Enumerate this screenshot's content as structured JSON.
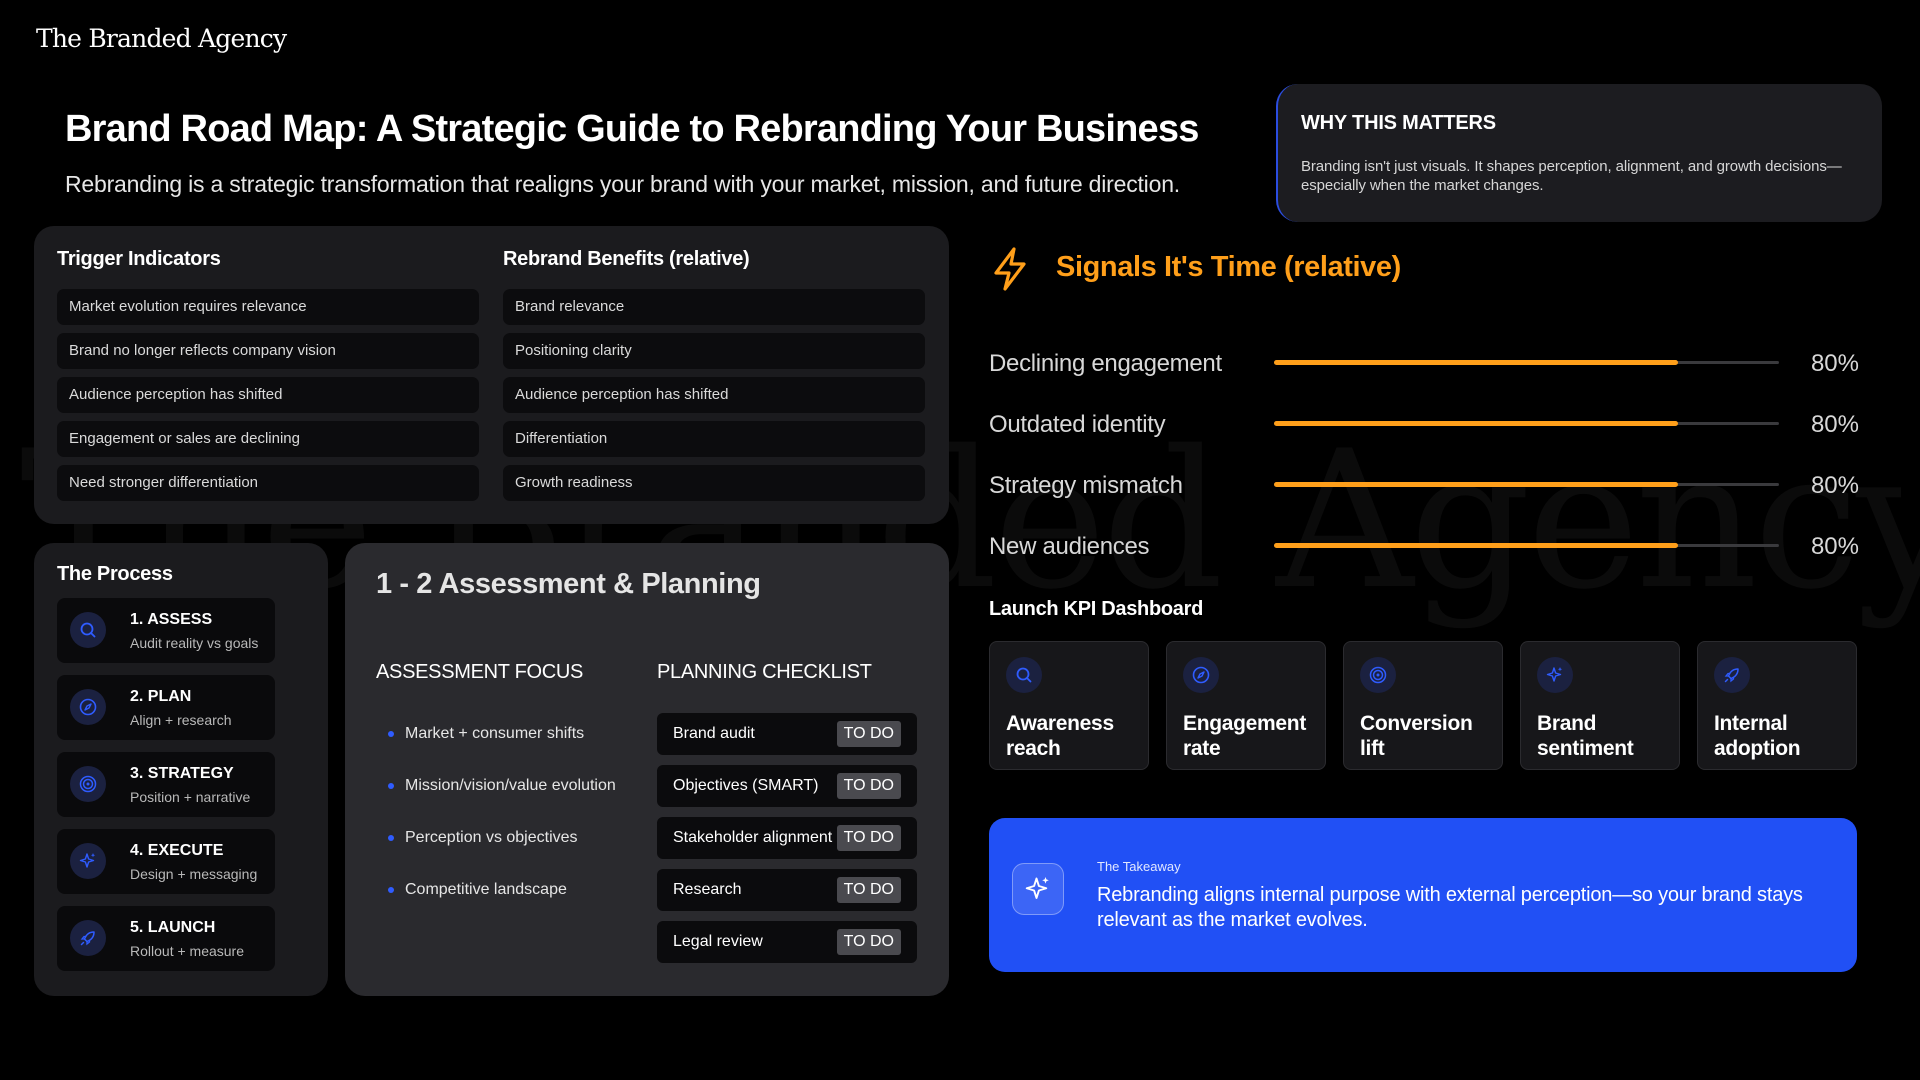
{
  "brand": {
    "logo": "The Branded Agency",
    "watermark": "The Branded Agency"
  },
  "header": {
    "title": "Brand Road Map: A Strategic Guide to Rebranding Your Business",
    "subtitle": "Rebranding is a strategic transformation that realigns your brand with your market, mission, and future direction."
  },
  "why": {
    "title": "WHY THIS MATTERS",
    "body": "Branding isn't just visuals. It shapes perception, alignment, and growth decisions—especially when the market changes."
  },
  "triggers": {
    "title": "Trigger Indicators",
    "items": [
      "Market evolution requires relevance",
      "Brand no longer reflects company vision",
      "Audience perception has shifted",
      "Engagement or sales are declining",
      "Need stronger differentiation"
    ]
  },
  "benefits": {
    "title": "Rebrand Benefits (relative)",
    "items": [
      "Brand relevance",
      "Positioning clarity",
      "Audience perception has shifted",
      "Differentiation",
      "Growth readiness"
    ]
  },
  "process": {
    "title": "The Process",
    "steps": [
      {
        "name": "1. ASSESS",
        "desc": "Audit reality vs goals",
        "icon": "search-icon"
      },
      {
        "name": "2. PLAN",
        "desc": "Align + research",
        "icon": "compass-icon"
      },
      {
        "name": "3. STRATEGY",
        "desc": "Position + narrative",
        "icon": "target-icon"
      },
      {
        "name": "4. EXECUTE",
        "desc": "Design + messaging",
        "icon": "sparkles-icon"
      },
      {
        "name": "5. LAUNCH",
        "desc": "Rollout + measure",
        "icon": "rocket-icon"
      }
    ]
  },
  "assessment": {
    "title": "1 - 2 Assessment & Planning",
    "focus_title": "ASSESSMENT FOCUS",
    "focus_items": [
      "Market + consumer shifts",
      "Mission/vision/value evolution",
      "Perception vs objectives",
      "Competitive landscape"
    ],
    "checklist_title": "PLANNING CHECKLIST",
    "checklist": [
      {
        "label": "Brand audit",
        "status": "TO DO"
      },
      {
        "label": "Objectives (SMART)",
        "status": "TO DO"
      },
      {
        "label": "Stakeholder alignment",
        "status": "TO DO"
      },
      {
        "label": "Research",
        "status": "TO DO"
      },
      {
        "label": "Legal review",
        "status": "TO DO"
      }
    ]
  },
  "signals": {
    "title": "Signals It's Time (relative)",
    "icon": "lightning-icon",
    "rows": [
      {
        "label": "Declining engagement",
        "value": 0.8,
        "pct": "80%"
      },
      {
        "label": "Outdated identity",
        "value": 0.8,
        "pct": "80%"
      },
      {
        "label": "Strategy mismatch",
        "value": 0.8,
        "pct": "80%"
      },
      {
        "label": "New audiences",
        "value": 0.8,
        "pct": "80%"
      }
    ]
  },
  "kpi": {
    "title": "Launch KPI Dashboard",
    "cards": [
      {
        "label": "Awareness reach",
        "icon": "search-icon"
      },
      {
        "label": "Engagement rate",
        "icon": "compass-icon"
      },
      {
        "label": "Conversion lift",
        "icon": "target-icon"
      },
      {
        "label": "Brand sentiment",
        "icon": "sparkles-icon"
      },
      {
        "label": "Internal adoption",
        "icon": "rocket-icon"
      }
    ]
  },
  "takeaway": {
    "kicker": "The Takeaway",
    "body": "Rebranding aligns internal purpose with external perception—so your brand stays relevant as the market evolves.",
    "icon": "sparkles-icon"
  },
  "colors": {
    "accent_orange": "#ff9f1a",
    "accent_blue": "#2150f5",
    "icon_blue": "#2f5cff"
  }
}
